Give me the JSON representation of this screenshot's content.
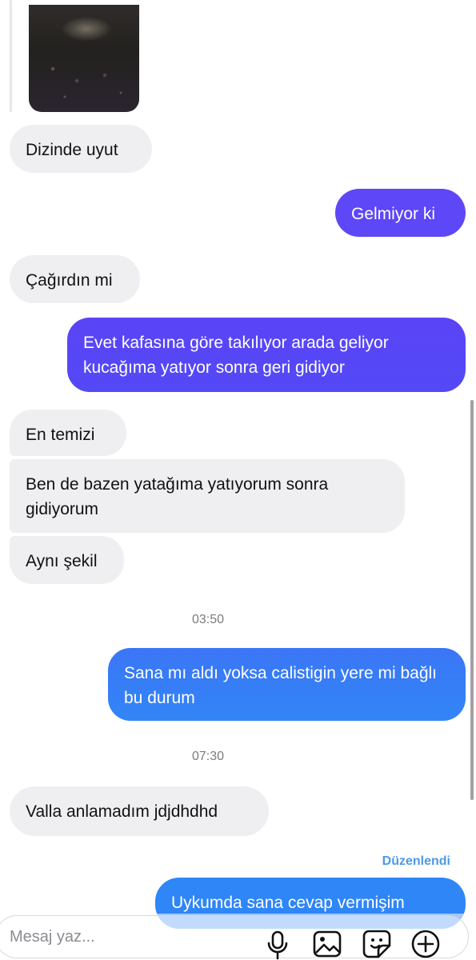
{
  "messages": [
    {
      "id": "m1",
      "side": "received",
      "text": "Dizinde uyut"
    },
    {
      "id": "m2",
      "side": "sent",
      "text": "Gelmiyor ki"
    },
    {
      "id": "m3",
      "side": "received",
      "text": "Çağırdın mi"
    },
    {
      "id": "m4",
      "side": "sent",
      "text": "Evet kafasına göre takılıyor arada geliyor kucağıma yatıyor sonra geri gidiyor"
    },
    {
      "id": "m5",
      "side": "received",
      "text": "En temizi"
    },
    {
      "id": "m6",
      "side": "received",
      "text": "Ben de bazen yatağıma yatıyorum sonra gidiyorum"
    },
    {
      "id": "m7",
      "side": "received",
      "text": "Aynı şekil"
    },
    {
      "id": "m8",
      "side": "sent",
      "text": "Sana mı aldı yoksa calistigin yere mi bağlı bu durum"
    },
    {
      "id": "m9",
      "side": "received",
      "text": "Valla anlamadım jdjdhdhd"
    },
    {
      "id": "m10",
      "side": "sent",
      "text": "Uykumda sana cevap vermişim"
    }
  ],
  "timestamps": {
    "t1": "03:50",
    "t2": "07:30"
  },
  "edited_label": "Düzenlendi",
  "composer": {
    "placeholder": "Mesaj yaz...",
    "icons": [
      "microphone-icon",
      "image-icon",
      "sticker-icon",
      "plus-circle-icon"
    ]
  },
  "colors": {
    "received_bubble": "#efeff2",
    "sent_gradient_top": "#6a3cf5",
    "sent_gradient_bottom": "#2f83f7",
    "edited_label": "#4d9ae6"
  }
}
